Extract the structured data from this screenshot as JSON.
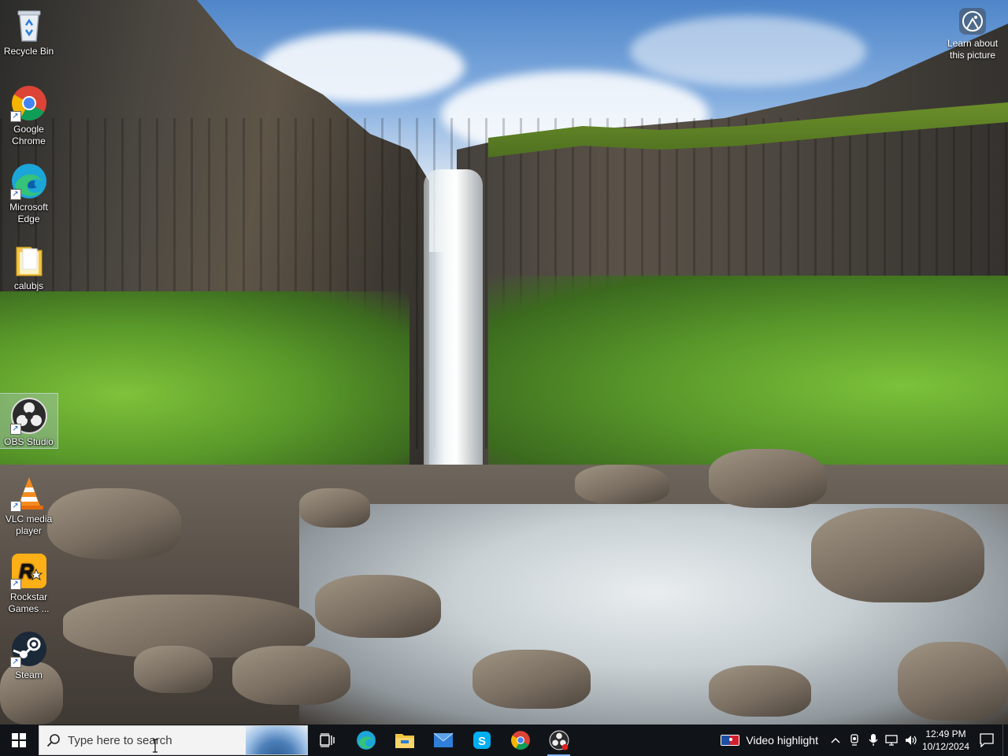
{
  "desktop": {
    "icons": [
      {
        "label": "Recycle Bin"
      },
      {
        "label": "Google Chrome"
      },
      {
        "label": "Microsoft Edge"
      },
      {
        "label": "calubjs"
      },
      {
        "label": "OBS Studio"
      },
      {
        "label": "VLC media player"
      },
      {
        "label": "Rockstar Games ..."
      },
      {
        "label": "Steam"
      }
    ],
    "learn_label": "Learn about this picture"
  },
  "taskbar": {
    "search_placeholder": "Type here to search",
    "news_label": "Video highlight",
    "time": "12:49 PM",
    "date": "10/12/2024",
    "accent": "#101418"
  }
}
